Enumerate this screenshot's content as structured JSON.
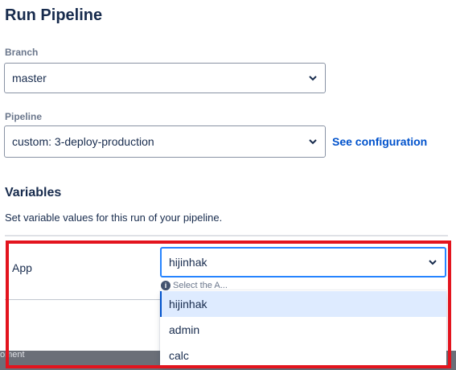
{
  "page": {
    "title": "Run Pipeline"
  },
  "branch": {
    "label": "Branch",
    "value": "master"
  },
  "pipeline": {
    "label": "Pipeline",
    "value": "custom: 3-deploy-production",
    "see_config": "See configuration"
  },
  "variables": {
    "title": "Variables",
    "description": "Set variable values for this run of your pipeline.",
    "app_label": "App",
    "app_value": "hijinhak",
    "app_helper": "Select the A...",
    "options": [
      "hijinhak",
      "admin",
      "calc"
    ],
    "selected_index": 0
  },
  "background": {
    "partial_text": "oment"
  },
  "colors": {
    "accent": "#0052cc",
    "highlight": "#e3141e",
    "selected_bg": "#deebff"
  },
  "icons": {
    "dropdown": "chevron-down-icon",
    "info": "info-icon"
  }
}
